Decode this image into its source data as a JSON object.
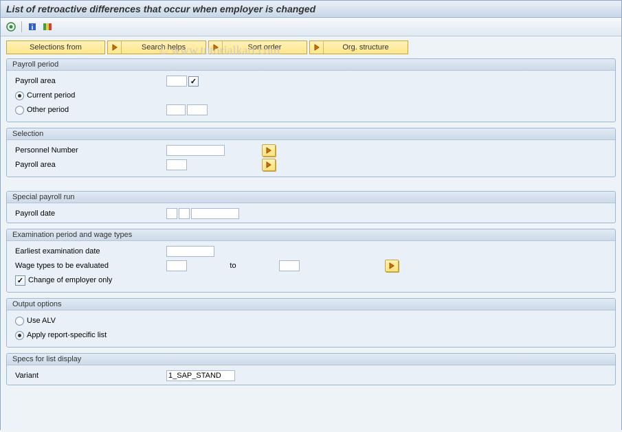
{
  "title": "List of retroactive differences that occur when employer is changed",
  "watermark": "© www.tutorialkart.com",
  "toolbar": {
    "execute_icon": "execute-icon",
    "info_icon": "info-icon",
    "abc_icon": "abc-icon"
  },
  "buttons": {
    "selections_from": "Selections from",
    "search_helps": "Search helps",
    "sort_order": "Sort order",
    "org_structure": "Org. structure"
  },
  "groups": {
    "payroll_period": {
      "title": "Payroll period",
      "payroll_area_label": "Payroll area",
      "current_period_label": "Current period",
      "other_period_label": "Other period",
      "payroll_area_value": "",
      "period_selected": "current",
      "other_period_v1": "",
      "other_period_v2": ""
    },
    "selection": {
      "title": "Selection",
      "personnel_number_label": "Personnel Number",
      "personnel_number_value": "",
      "payroll_area_label": "Payroll area",
      "payroll_area_value": ""
    },
    "special_payroll": {
      "title": "Special payroll run",
      "payroll_date_label": "Payroll date",
      "val1": "",
      "val2": "",
      "val3": ""
    },
    "examination": {
      "title": "Examination period and wage types",
      "earliest_label": "Earliest examination date",
      "earliest_value": "",
      "wage_types_label": "Wage types to be evaluated",
      "wage_types_from": "",
      "to_label": "to",
      "wage_types_to": "",
      "change_employer_label": "Change of employer only",
      "change_employer_checked": true
    },
    "output_options": {
      "title": "Output options",
      "use_alv_label": "Use ALV",
      "apply_report_label": "Apply report-specific list",
      "selected": "apply"
    },
    "specs": {
      "title": "Specs for list display",
      "variant_label": "Variant",
      "variant_value": "1_SAP_STAND"
    }
  }
}
